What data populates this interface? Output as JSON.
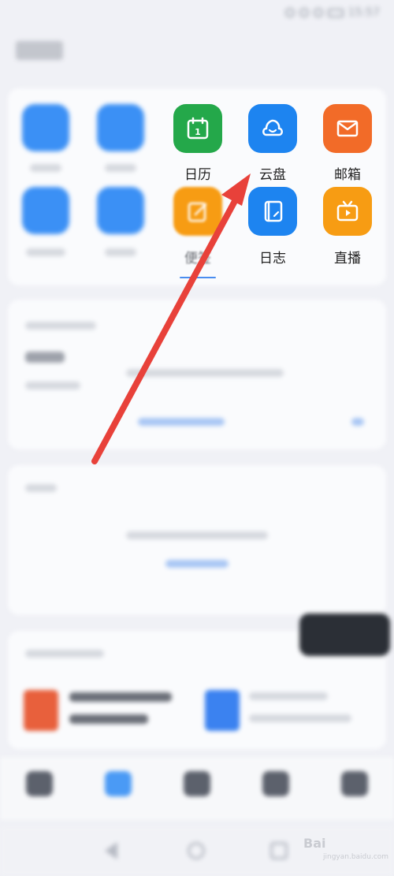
{
  "status_bar": {
    "time": "15:57"
  },
  "popup_apps": [
    {
      "label": "日历",
      "icon": "calendar-icon",
      "color": "#24a84a",
      "day": "1"
    },
    {
      "label": "云盘",
      "icon": "cloud-icon",
      "color": "#1d84f0"
    },
    {
      "label": "邮箱",
      "icon": "mail-icon",
      "color": "#f26b28"
    },
    {
      "label": "便签",
      "icon": "note-icon",
      "color": "#f79c13"
    },
    {
      "label": "日志",
      "icon": "journal-icon",
      "color": "#1d84f0"
    },
    {
      "label": "直播",
      "icon": "tv-icon",
      "color": "#f79c13"
    }
  ],
  "annotation": {
    "arrow_color": "#e8413a"
  },
  "watermark": {
    "text": "Bai",
    "sub": "jingyan.baidu.com"
  }
}
